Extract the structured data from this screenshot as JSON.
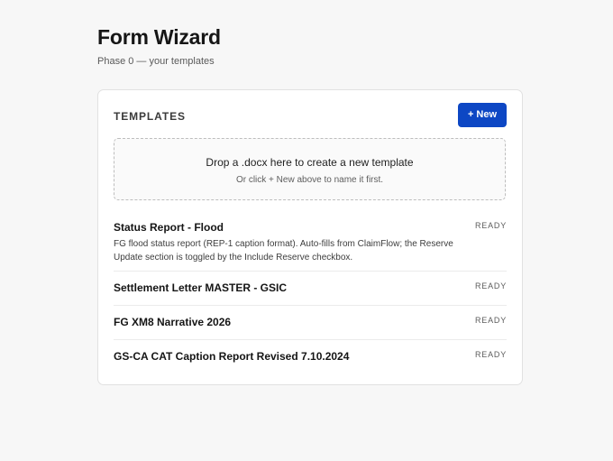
{
  "header": {
    "title": "Form Wizard",
    "subtitle": "Phase 0 — your templates"
  },
  "templates_card": {
    "heading": "TEMPLATES",
    "new_button_label": "+ New",
    "dropzone": {
      "title": "Drop a .docx here to create a new template",
      "hint": "Or click + New above to name it first."
    },
    "items": [
      {
        "name": "Status Report - Flood",
        "description": "FG flood status report (REP-1 caption format). Auto-fills from ClaimFlow; the Reserve Update section is toggled by the Include Reserve checkbox.",
        "status": "READY"
      },
      {
        "name": "Settlement Letter MASTER - GSIC",
        "status": "READY"
      },
      {
        "name": "FG XM8 Narrative 2026",
        "status": "READY"
      },
      {
        "name": "GS-CA CAT Caption Report Revised 7.10.2024",
        "status": "READY"
      }
    ]
  },
  "colors": {
    "page_background": "#f7f7f7",
    "card_background": "#ffffff",
    "primary_button": "#0d47c4"
  }
}
